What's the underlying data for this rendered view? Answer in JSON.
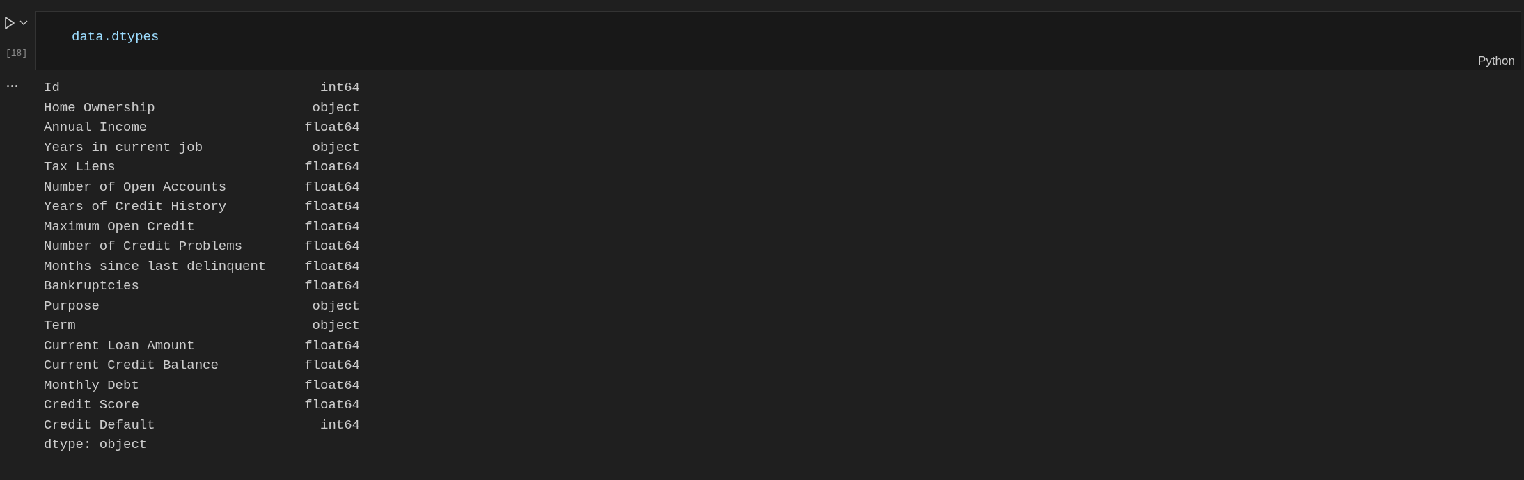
{
  "cell": {
    "code": "data.dtypes",
    "execution_count": "[18]",
    "language": "Python"
  },
  "output": {
    "rows": [
      {
        "name": "Id",
        "dtype": "int64"
      },
      {
        "name": "Home Ownership",
        "dtype": "object"
      },
      {
        "name": "Annual Income",
        "dtype": "float64"
      },
      {
        "name": "Years in current job",
        "dtype": "object"
      },
      {
        "name": "Tax Liens",
        "dtype": "float64"
      },
      {
        "name": "Number of Open Accounts",
        "dtype": "float64"
      },
      {
        "name": "Years of Credit History",
        "dtype": "float64"
      },
      {
        "name": "Maximum Open Credit",
        "dtype": "float64"
      },
      {
        "name": "Number of Credit Problems",
        "dtype": "float64"
      },
      {
        "name": "Months since last delinquent",
        "dtype": "float64"
      },
      {
        "name": "Bankruptcies",
        "dtype": "float64"
      },
      {
        "name": "Purpose",
        "dtype": "object"
      },
      {
        "name": "Term",
        "dtype": "object"
      },
      {
        "name": "Current Loan Amount",
        "dtype": "float64"
      },
      {
        "name": "Current Credit Balance",
        "dtype": "float64"
      },
      {
        "name": "Monthly Debt",
        "dtype": "float64"
      },
      {
        "name": "Credit Score",
        "dtype": "float64"
      },
      {
        "name": "Credit Default",
        "dtype": "int64"
      }
    ],
    "footer": "dtype: object"
  }
}
